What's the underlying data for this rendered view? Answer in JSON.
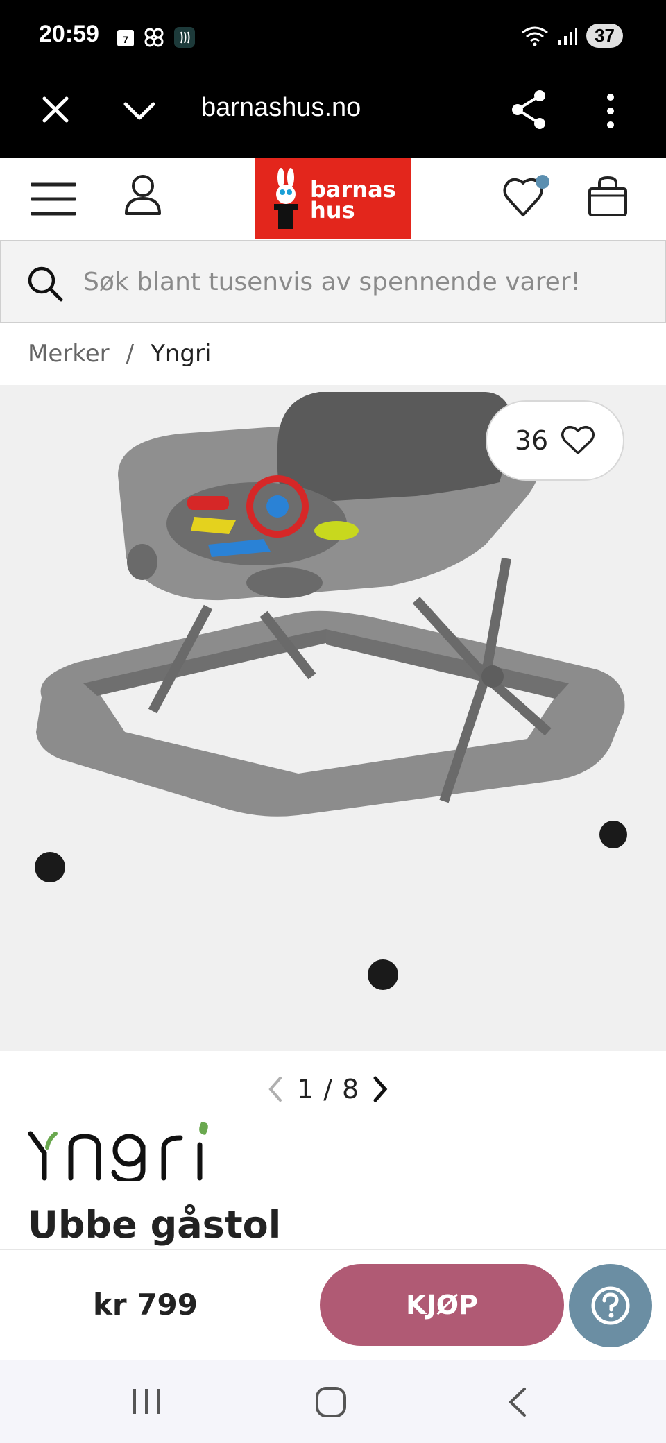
{
  "status_bar": {
    "time": "20:59",
    "calendar_day": "7",
    "battery": "37"
  },
  "browser": {
    "url": "barnashus.no"
  },
  "site": {
    "logo_line1": "barnas",
    "logo_line2": "hus",
    "wishlist_badge_color": "#5b8fb0"
  },
  "search": {
    "placeholder": "Søk blant tusenvis av spennende varer!"
  },
  "breadcrumb": {
    "items": [
      "Merker",
      "Yngri"
    ],
    "separator": "/"
  },
  "product": {
    "like_count": "36",
    "image_index": "1",
    "image_separator": "/",
    "image_total": "8",
    "brand": "Yngri",
    "title": "Ubbe gåstol",
    "price": "kr 799",
    "buy_label": "KJØP"
  },
  "colors": {
    "brand_red": "#e3261c",
    "buy_button": "#b05a74",
    "help_button": "#6b8ea3"
  }
}
